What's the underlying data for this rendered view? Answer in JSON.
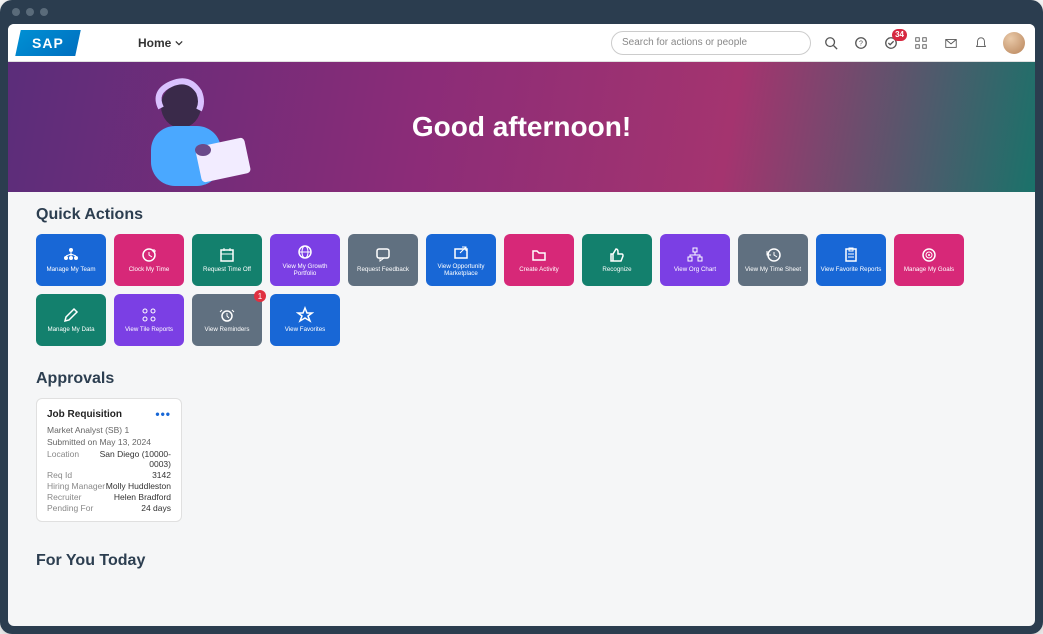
{
  "header": {
    "logo_text": "SAP",
    "home_label": "Home",
    "search_placeholder": "Search for actions or people",
    "notification_badge": "34"
  },
  "hero": {
    "title": "Good afternoon!"
  },
  "quick_actions": {
    "title": "Quick Actions",
    "tiles": [
      {
        "label": "Manage My Team",
        "color": "blue",
        "icon": "tree"
      },
      {
        "label": "Clock My Time",
        "color": "pink",
        "icon": "clock-plus"
      },
      {
        "label": "Request Time Off",
        "color": "teal",
        "icon": "calendar"
      },
      {
        "label": "View My Growth Portfolio",
        "color": "purple",
        "icon": "globe"
      },
      {
        "label": "Request Feedback",
        "color": "gray",
        "icon": "chat"
      },
      {
        "label": "View Opportunity Marketplace",
        "color": "blue",
        "icon": "launch"
      },
      {
        "label": "Create Activity",
        "color": "pink",
        "icon": "folder"
      },
      {
        "label": "Recognize",
        "color": "teal",
        "icon": "thumb"
      },
      {
        "label": "View Org Chart",
        "color": "purple",
        "icon": "org"
      },
      {
        "label": "View My Time Sheet",
        "color": "gray",
        "icon": "history"
      },
      {
        "label": "View Favorite Reports",
        "color": "blue",
        "icon": "clipboard"
      },
      {
        "label": "Manage My Goals",
        "color": "pink",
        "icon": "target"
      },
      {
        "label": "Manage My Data",
        "color": "teal",
        "icon": "pencil"
      },
      {
        "label": "View Tile Reports",
        "color": "purple",
        "icon": "grid"
      },
      {
        "label": "View Reminders",
        "color": "gray",
        "icon": "reminder",
        "badge": "1"
      },
      {
        "label": "View Favorites",
        "color": "blue",
        "icon": "star"
      }
    ]
  },
  "approvals": {
    "title": "Approvals",
    "card": {
      "title": "Job Requisition",
      "subtitle": "Market Analyst (SB) 1",
      "submitted": "Submitted on May 13, 2024",
      "rows": [
        {
          "k": "Location",
          "v": "San Diego (10000-0003)"
        },
        {
          "k": "Req Id",
          "v": "3142"
        },
        {
          "k": "Hiring Manager",
          "v": "Molly Huddleston"
        },
        {
          "k": "Recruiter",
          "v": "Helen Bradford"
        },
        {
          "k": "Pending For",
          "v": "24 days"
        }
      ]
    }
  },
  "for_you": {
    "title": "For You Today"
  }
}
